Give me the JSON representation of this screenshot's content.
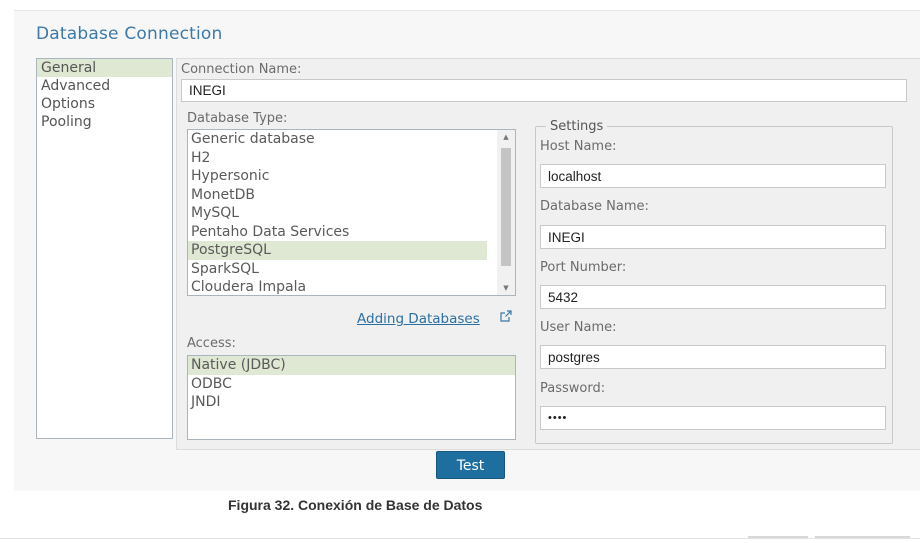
{
  "dialog": {
    "title": "Database Connection"
  },
  "nav": {
    "items": [
      {
        "label": "General",
        "selected": true
      },
      {
        "label": "Advanced",
        "selected": false
      },
      {
        "label": "Options",
        "selected": false
      },
      {
        "label": "Pooling",
        "selected": false
      }
    ]
  },
  "connection": {
    "name_label": "Connection Name:",
    "name_value": "INEGI"
  },
  "database_type": {
    "label": "Database Type:",
    "options": [
      "Generic database",
      "H2",
      "Hypersonic",
      "MonetDB",
      "MySQL",
      "Pentaho Data Services",
      "PostgreSQL",
      "SparkSQL",
      "Cloudera Impala"
    ],
    "selected": "PostgreSQL",
    "link_label": "Adding Databases"
  },
  "access": {
    "label": "Access:",
    "options": [
      "Native (JDBC)",
      "ODBC",
      "JNDI"
    ],
    "selected": "Native (JDBC)"
  },
  "settings": {
    "legend": "Settings",
    "host_label": "Host Name:",
    "host_value": "localhost",
    "dbname_label": "Database Name:",
    "dbname_value": "INEGI",
    "port_label": "Port Number:",
    "port_value": "5432",
    "user_label": "User Name:",
    "user_value": "postgres",
    "password_label": "Password:",
    "password_value": "••••"
  },
  "buttons": {
    "test_label": "Test"
  },
  "caption": "Figura 32. Conexión de Base de Datos",
  "colors": {
    "accent": "#1e6fa0",
    "title": "#3d79a8",
    "selection": "#dfe8d2",
    "link": "#2c6fa3"
  }
}
